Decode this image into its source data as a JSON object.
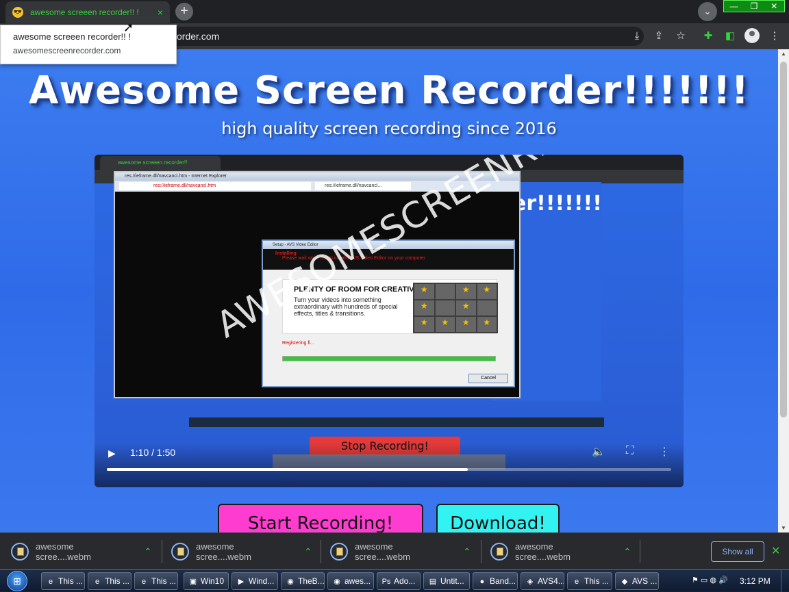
{
  "browser": {
    "tab_title": "awesome screeen recorder!! !",
    "tab_favicon": "😎",
    "tab_close": "×",
    "new_tab": "+",
    "tab_search": "⌄",
    "url": "awesomescreenrecorder.com",
    "url_visible": "order.com",
    "window_controls": [
      "—",
      "❐",
      "✕"
    ],
    "accent_color": "#35d23b"
  },
  "tooltip": {
    "title": "awesome screeen recorder!! !",
    "url": "awesomescreenrecorder.com"
  },
  "page": {
    "title": "Awesome Screen Recorder!!!!!!!",
    "subtitle": "high quality screen recording since 2016",
    "background_color": "#3370ea"
  },
  "video": {
    "current_time": "1:10",
    "duration": "1:50",
    "time_display": "1:10 / 1:50",
    "progress": 0.64,
    "watermark": "AWESOMESCREENRECORDER.COM",
    "embedded": {
      "tab_title": "awesome screeen recorder!!",
      "ie_title": "res://ieframe.dll/navcancl.htm - Internet Explorer",
      "ie_address": "res://ieframe.dll/navcancl.htm",
      "ie_tab": "res://ieframe.dll/navcancl...",
      "back_text": "er!!!!!!!",
      "installer_title": "Setup - AVS Video Editor",
      "installer_heading": "Installing",
      "installer_sub": "Please wait while Setup installs AVS Video Editor on your computer.",
      "installer_promo_title": "PLENTY OF ROOM FOR CREATIVITY",
      "installer_promo_text": "Turn your videos into something extraordinary with hundreds of special effects, titles & transitions.",
      "installer_reg": "Registering fi...",
      "installer_cancel": "Cancel",
      "stop_button": "Stop Recording!"
    }
  },
  "buttons": {
    "start": "Start Recording!",
    "download": "Download!"
  },
  "downloads": {
    "items": [
      {
        "name": "awesome scree....webm"
      },
      {
        "name": "awesome scree....webm"
      },
      {
        "name": "awesome scree....webm"
      },
      {
        "name": "awesome scree....webm"
      }
    ],
    "show_all": "Show all",
    "close": "✕"
  },
  "taskbar": {
    "items": [
      {
        "label": "This ...",
        "icon": "e"
      },
      {
        "label": "This ...",
        "icon": "e"
      },
      {
        "label": "This ...",
        "icon": "e"
      },
      {
        "label": "Win10",
        "icon": "▣"
      },
      {
        "label": "Wind...",
        "icon": "▶"
      },
      {
        "label": "TheB...",
        "icon": "◉"
      },
      {
        "label": "awes...",
        "icon": "◉"
      },
      {
        "label": "Ado...",
        "icon": "Ps"
      },
      {
        "label": "Untit...",
        "icon": "▤"
      },
      {
        "label": "Band...",
        "icon": "●"
      },
      {
        "label": "AVS4...",
        "icon": "◈"
      },
      {
        "label": "This ...",
        "icon": "e"
      },
      {
        "label": "AVS ...",
        "icon": "◆"
      }
    ],
    "clock": "3:12 PM"
  }
}
